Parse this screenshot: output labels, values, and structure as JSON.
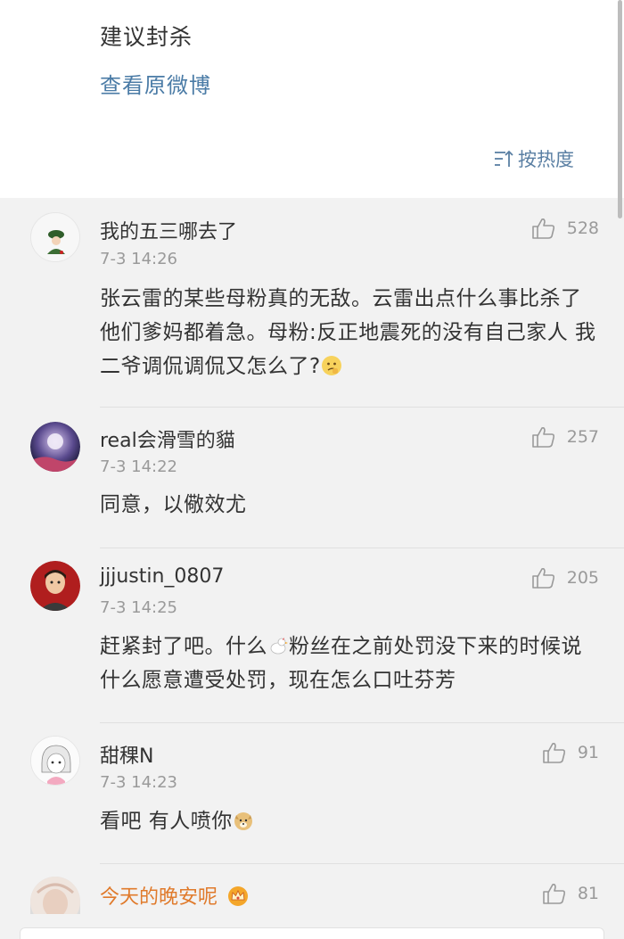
{
  "post": {
    "text": "建议封杀",
    "view_original": "查看原微博",
    "sort_label": "按热度"
  },
  "comments": [
    {
      "username": "我的五三哪去了",
      "time": "7-3 14:26",
      "text": "张云雷的某些母粉真的无敌。云雷出点什么事比杀了他们爹妈都着急。母粉:反正地震死的没有自己家人 我二爷调侃调侃又怎么了?",
      "emoji": "thinking-face",
      "likes": "528"
    },
    {
      "username": "real会滑雪的貓",
      "time": "7-3 14:22",
      "text": "同意，以儆效尤",
      "likes": "257"
    },
    {
      "username": "jjjustin_0807",
      "time": "7-3 14:25",
      "text_before": "赶紧封了吧。什么",
      "emoji": "chicken",
      "text_after": "粉丝在之前处罚没下来的时候说什么愿意遭受处罚，现在怎么口吐芬芳",
      "likes": "205"
    },
    {
      "username": "甜稞N",
      "time": "7-3 14:23",
      "text": "看吧 有人喷你",
      "emoji": "doge",
      "likes": "91"
    },
    {
      "username": "今天的晚安呢",
      "badge": "crown-icon",
      "likes": "81"
    }
  ],
  "colors": {
    "link": "#4a7ba6",
    "vip_name": "#e07a2b",
    "meta": "#9a9a9a",
    "background": "#f2f2f2"
  }
}
